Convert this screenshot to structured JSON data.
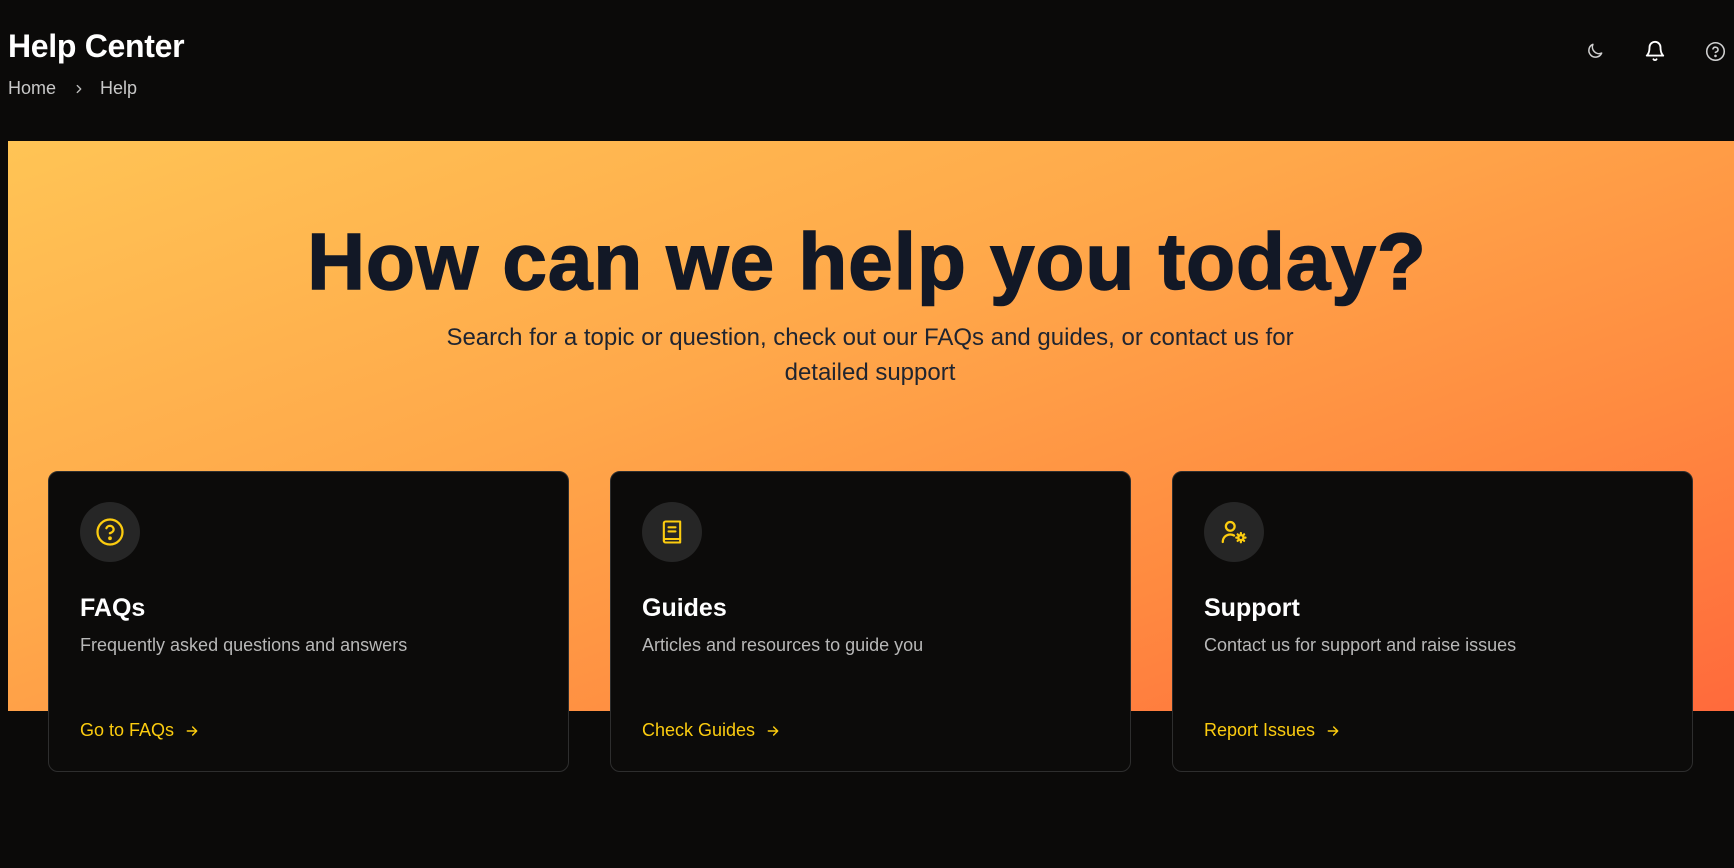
{
  "header": {
    "title": "Help Center",
    "breadcrumb": [
      "Home",
      "Help"
    ]
  },
  "topbar": {
    "icons": [
      "moon-icon",
      "bell-icon",
      "help-circle-icon"
    ]
  },
  "hero": {
    "title": "How can we help you today?",
    "subtitle": "Search for a topic or question, check out our FAQs and guides, or contact us for detailed support"
  },
  "cards": [
    {
      "icon": "question-circle-icon",
      "title": "FAQs",
      "description": "Frequently asked questions and answers",
      "link": "Go to FAQs"
    },
    {
      "icon": "book-icon",
      "title": "Guides",
      "description": "Articles and resources to guide you",
      "link": "Check Guides"
    },
    {
      "icon": "user-gear-icon",
      "title": "Support",
      "description": "Contact us for support and raise issues",
      "link": "Report Issues"
    }
  ],
  "colors": {
    "accent": "#fccc0f",
    "background": "#0b0a09",
    "hero_gradient_start": "#ffc455",
    "hero_gradient_end": "#ff6a3c",
    "hero_text": "#121826"
  }
}
